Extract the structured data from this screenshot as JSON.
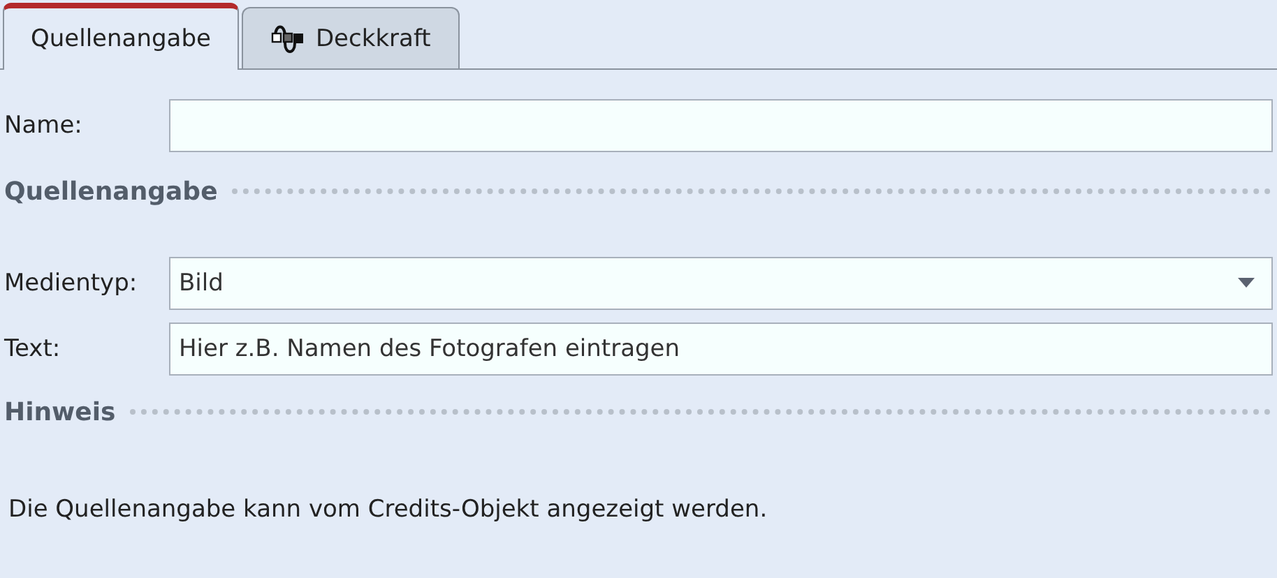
{
  "tabs": [
    {
      "label": "Quellenangabe",
      "selected": true,
      "icon": false
    },
    {
      "label": "Deckkraft",
      "selected": false,
      "icon": true
    }
  ],
  "name_field": {
    "label": "Name:"
  },
  "source_section": {
    "title": "Quellenangabe"
  },
  "media_type": {
    "label": "Medientyp:",
    "value": "Bild"
  },
  "text_field": {
    "label": "Text:",
    "value": "Hier z.B. Namen des Fotografen eintragen"
  },
  "note_section": {
    "title": "Hinweis",
    "text": "Die Quellenangabe kann vom Credits-Objekt angezeigt werden."
  }
}
